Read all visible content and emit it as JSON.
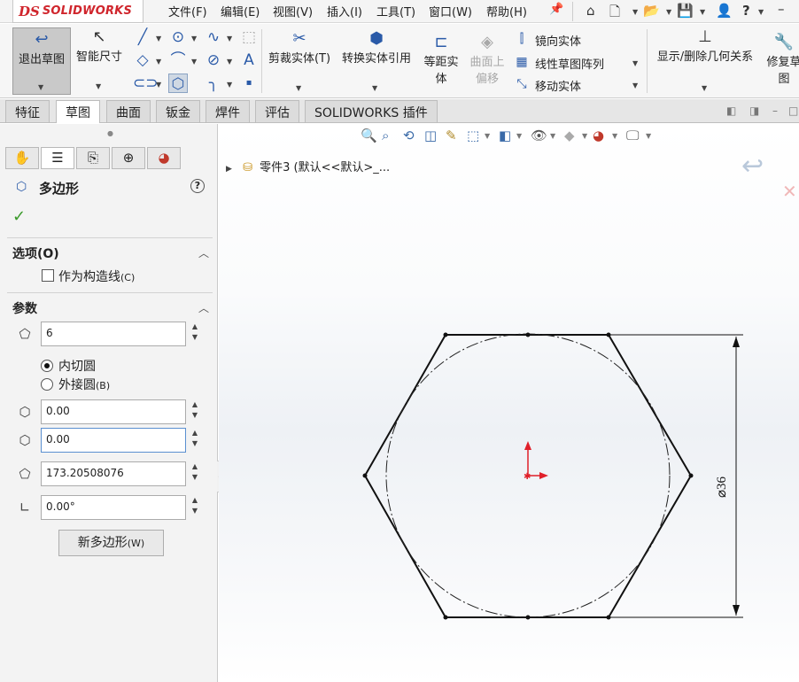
{
  "app": {
    "logo_ds": "DS",
    "logo_text": "SOLIDWORKS"
  },
  "menu": [
    "文件(F)",
    "编辑(E)",
    "视图(V)",
    "插入(I)",
    "工具(T)",
    "窗口(W)",
    "帮助(H)"
  ],
  "quick_access": {
    "home": "⌂",
    "new": "🗋",
    "open": "📂",
    "save": "💾",
    "user": "👤",
    "help": "?",
    "minimize": "–"
  },
  "command_manager": {
    "exit_sketch": "退出草图",
    "smart_dimension": "智能尺寸",
    "trim": "剪裁实体(T)",
    "convert": "转换实体引用",
    "offset": "等距实\n体",
    "offset_line1": "等距实",
    "offset_line2": "体",
    "surface_offset_line1": "曲面上",
    "surface_offset_line2": "偏移",
    "mirror": "镜向实体",
    "linear_pattern": "线性草图阵列",
    "move": "移动实体",
    "relations": "显示/删除几何关系",
    "repair_line1": "修复草",
    "repair_line2": "图"
  },
  "tabs": [
    "特征",
    "草图",
    "曲面",
    "钣金",
    "焊件",
    "评估",
    "SOLIDWORKS 插件"
  ],
  "active_tab": "草图",
  "property_manager": {
    "title": "多边形",
    "help": "?",
    "options_title": "选项(O)",
    "construction": "作为构造线",
    "construction_key": "(C)",
    "params_title": "参数",
    "sides": "6",
    "inscribed": "内切圆",
    "circumscribed": "外接圆",
    "circumscribed_key": "(B)",
    "center_x": "0.00",
    "center_y": "0.00",
    "diameter": "173.20508076",
    "angle": "0.00°",
    "new_polygon": "新多边形",
    "new_polygon_key": "(W)"
  },
  "feature_tree": {
    "node": "零件3  (默认<<默认>_..."
  },
  "sketch": {
    "polygon_sides": 6,
    "mode": "inscribed",
    "dimension_label": "⌀36"
  },
  "colors": {
    "brand_red": "#d0262d",
    "accent_blue": "#2a5aa8",
    "origin_red": "#e0202a"
  }
}
